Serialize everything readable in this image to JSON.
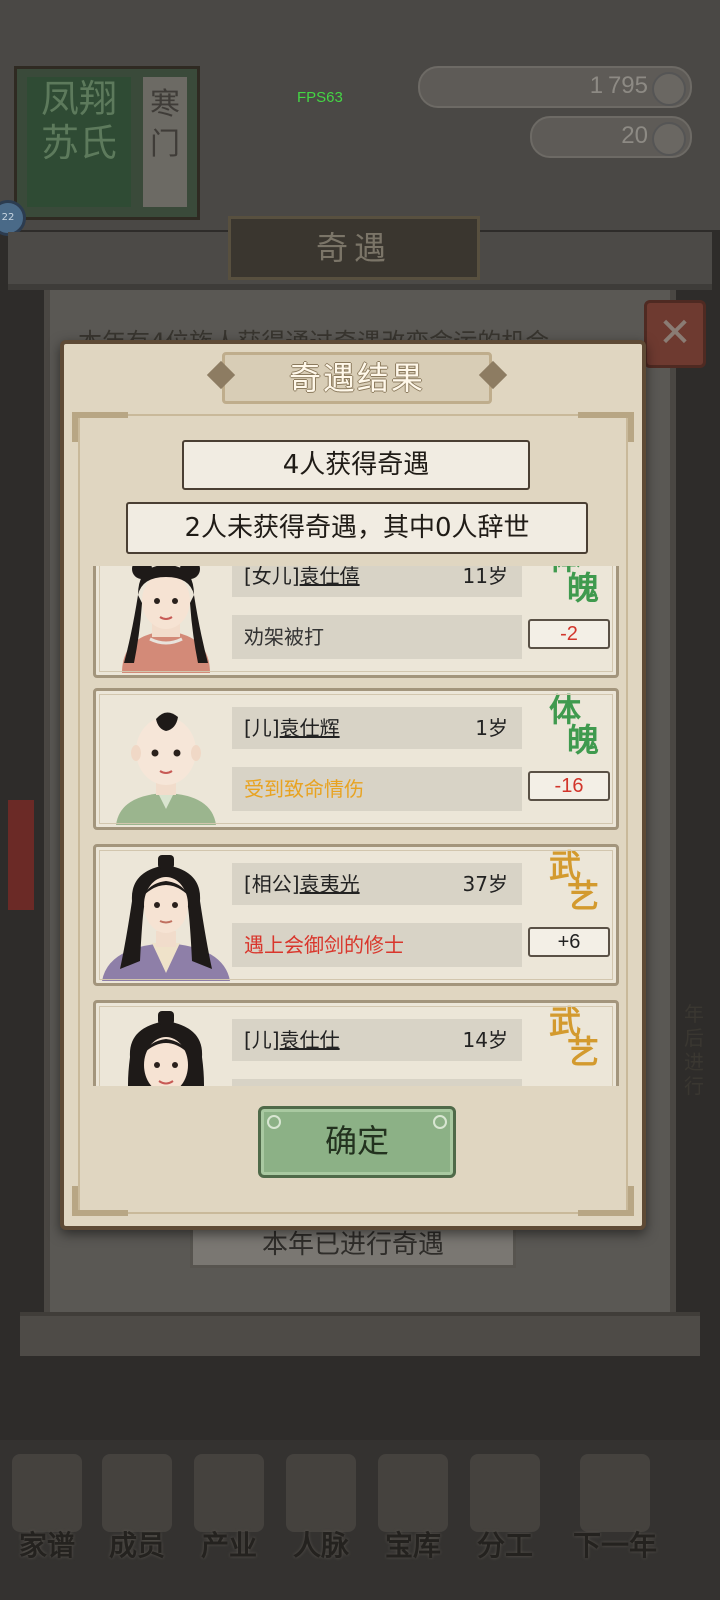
{
  "hud": {
    "fps": "FPS63",
    "resource1": "1 795",
    "resource2": "20",
    "clan_banner_left": "凤翔苏氏",
    "clan_banner_right": "寒门",
    "badge": "22"
  },
  "background": {
    "title": "奇遇",
    "intro_text": "本年有4位族人获得通过奇遇改变命运的机会",
    "year_done": "本年已进行奇遇",
    "side_text": "年后进行"
  },
  "dialog": {
    "title": "奇遇结果",
    "stat_gained": "4人获得奇遇",
    "stat_missed": "2人未获得奇遇，其中0人辞世",
    "confirm_label": "确定"
  },
  "results": [
    {
      "relation": "[女儿]",
      "name": "袁仕僖",
      "age": "11岁",
      "event": "劝架被打",
      "event_color": "#333333",
      "attribute": "体魄",
      "attribute_color": "#3f9a4e",
      "delta": "-2",
      "delta_color": "#d2352b"
    },
    {
      "relation": "[儿]",
      "name": "袁仕辉",
      "age": "1岁",
      "event": "受到致命情伤",
      "event_color": "#e8a321",
      "attribute": "体魄",
      "attribute_color": "#3f9a4e",
      "delta": "-16",
      "delta_color": "#d2352b"
    },
    {
      "relation": "[相公]",
      "name": "袁夷光",
      "age": "37岁",
      "event": "遇上会御剑的修士",
      "event_color": "#d9362c",
      "attribute": "武艺",
      "attribute_color": "#d39a2e",
      "delta": "+6",
      "delta_color": "#222222"
    },
    {
      "relation": "[儿]",
      "name": "袁仕仕",
      "age": "14岁",
      "event": "",
      "event_color": "#333333",
      "attribute": "武艺",
      "attribute_color": "#d39a2e",
      "delta": "",
      "delta_color": "#222222"
    }
  ],
  "nav": [
    {
      "label": "家谱",
      "icon": "book-icon"
    },
    {
      "label": "成员",
      "icon": "person-icon"
    },
    {
      "label": "产业",
      "icon": "building-icon"
    },
    {
      "label": "人脉",
      "icon": "network-icon"
    },
    {
      "label": "宝库",
      "icon": "chest-icon"
    },
    {
      "label": "分工",
      "icon": "scroll-icon"
    },
    {
      "label": "下一年",
      "icon": "lantern-icon"
    }
  ]
}
